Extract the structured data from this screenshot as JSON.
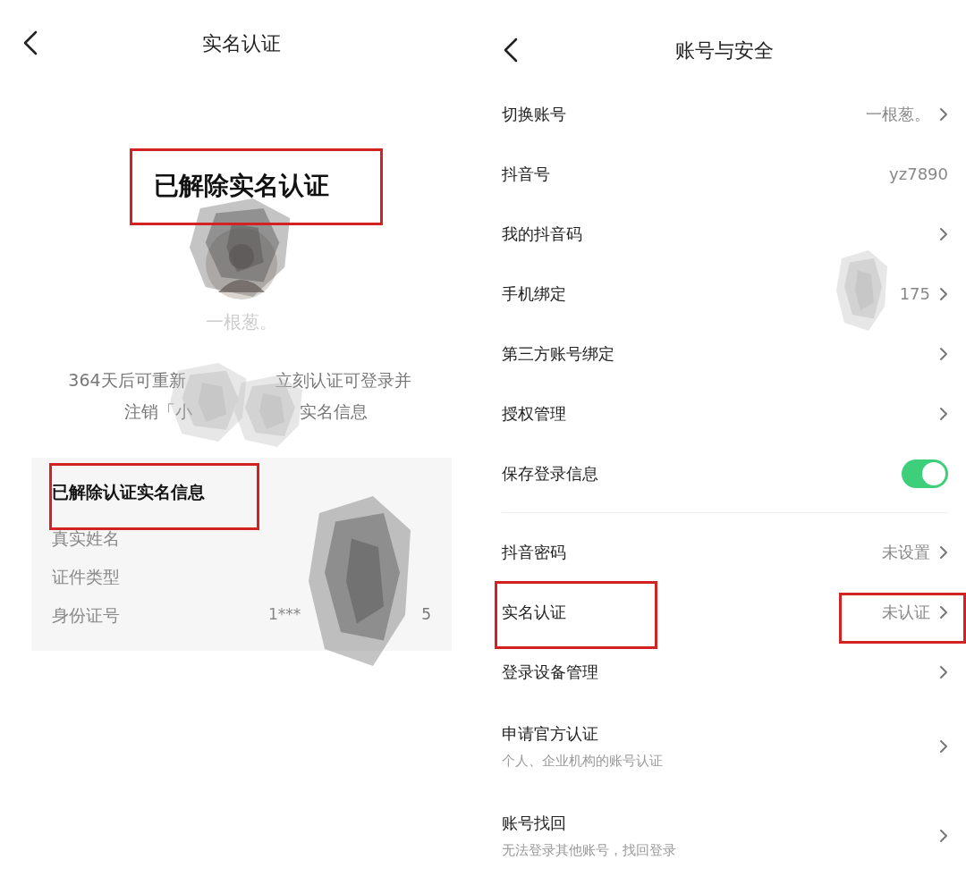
{
  "left": {
    "title": "实名认证",
    "status": "已解除实名认证",
    "name": "一根葱。",
    "notice": [
      [
        "364天后可重新",
        "立刻认证可登录并"
      ],
      [
        "注销「小",
        "实名信息"
      ]
    ],
    "card": {
      "title": "已解除认证实名信息",
      "rows": [
        {
          "label": "真实姓名"
        },
        {
          "label": "证件类型"
        },
        {
          "label": "身份证号",
          "value": "1***",
          "value_tail": "5"
        }
      ]
    }
  },
  "right": {
    "title": "账号与安全",
    "rows": [
      {
        "kind": "link",
        "label": "切换账号",
        "value": "一根葱。"
      },
      {
        "kind": "text",
        "label": "抖音号",
        "value": "yz7890"
      },
      {
        "kind": "link",
        "label": "我的抖音码"
      },
      {
        "kind": "link",
        "label": "手机绑定",
        "value": "175"
      },
      {
        "kind": "link",
        "label": "第三方账号绑定"
      },
      {
        "kind": "link",
        "label": "授权管理"
      },
      {
        "kind": "toggle",
        "label": "保存登录信息",
        "on": true
      },
      {
        "kind": "divider"
      },
      {
        "kind": "link",
        "label": "抖音密码",
        "value": "未设置"
      },
      {
        "kind": "link",
        "label": "实名认证",
        "value": "未认证"
      },
      {
        "kind": "link",
        "label": "登录设备管理"
      },
      {
        "kind": "link",
        "label": "申请官方认证",
        "subtitle": "个人、企业机构的账号认证"
      },
      {
        "kind": "link",
        "label": "账号找回",
        "subtitle": "无法登录其他账号，找回登录"
      }
    ]
  }
}
